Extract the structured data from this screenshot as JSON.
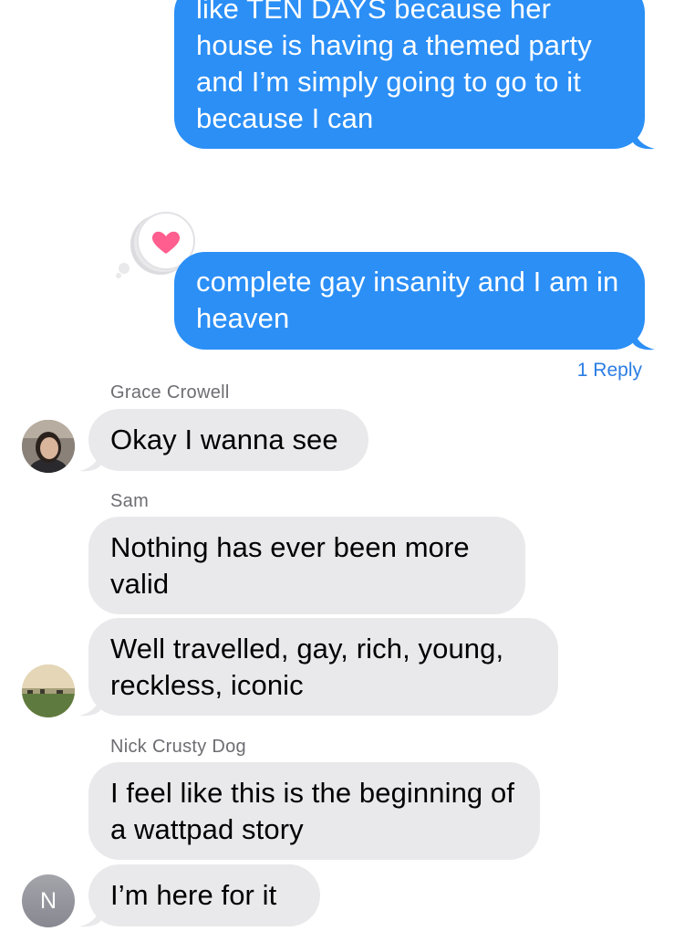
{
  "messages": {
    "out1": {
      "text": "like TEN DAYS because her house is having a themed party and I’m simply going to go to it because I can"
    },
    "out2": {
      "text": "complete gay insanity and I am in heaven",
      "tapback_icon": "heart-icon",
      "replies": "1 Reply"
    },
    "grace": {
      "sender": "Grace Crowell",
      "text": "Okay I wanna see"
    },
    "sam1": {
      "sender": "Sam",
      "text": "Nothing has ever been more valid"
    },
    "sam2": {
      "text": "Well travelled, gay, rich, young, reckless, iconic"
    },
    "nick1": {
      "sender": "Nick Crusty Dog",
      "text": "I feel like this is the beginning of a wattpad story"
    },
    "nick2": {
      "text": "I’m here for it",
      "avatar_initial": "N"
    }
  },
  "colors": {
    "outgoing_bubble": "#2b8ff6",
    "incoming_bubble": "#e9e9eb",
    "tapback_heart": "#ff5e8e",
    "link": "#2b7de4"
  }
}
